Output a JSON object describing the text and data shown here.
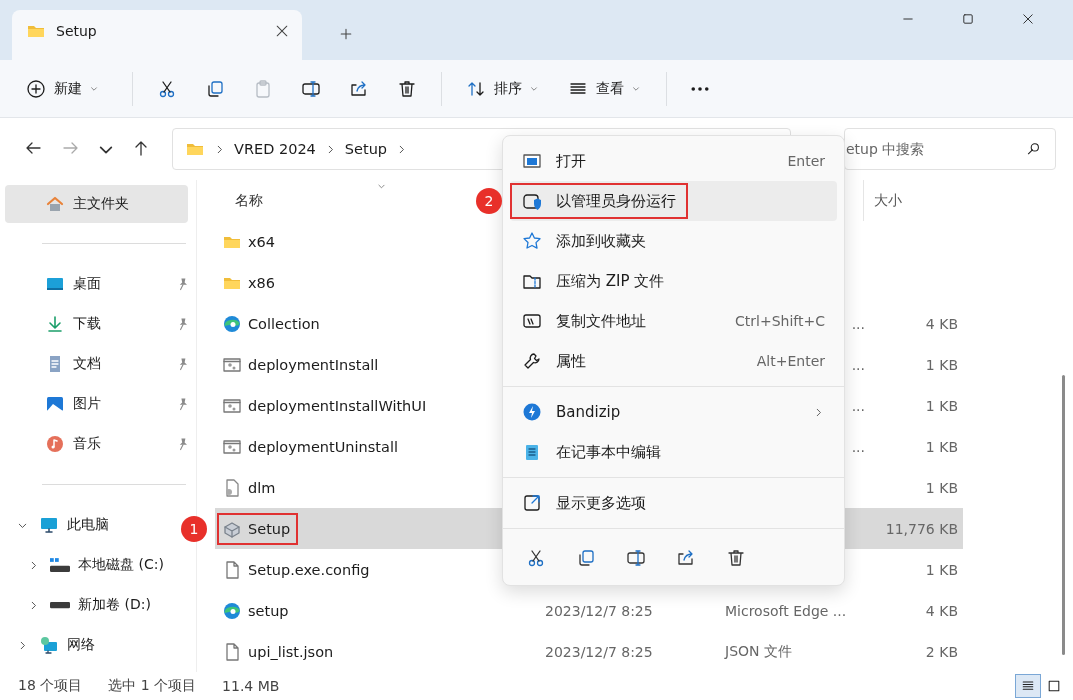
{
  "window": {
    "tab_title": "Setup"
  },
  "toolbar": {
    "groups": [
      [
        {
          "label": "新建",
          "dropdown": true,
          "disabled": false
        }
      ],
      [
        {
          "dropdown": false,
          "disabled": false
        },
        {
          "dropdown": false,
          "disabled": false
        },
        {
          "dropdown": false,
          "disabled": true
        },
        {
          "dropdown": false,
          "disabled": false
        },
        {
          "dropdown": false,
          "disabled": false
        },
        {
          "dropdown": false,
          "disabled": false
        }
      ],
      [
        {
          "label": "排序",
          "dropdown": true,
          "disabled": false
        },
        {
          "label": "查看",
          "dropdown": true,
          "disabled": false
        }
      ],
      [
        {
          "dropdown": false,
          "disabled": false
        }
      ]
    ]
  },
  "address": {
    "nav": [
      {
        "disabled": false
      },
      {
        "disabled": true
      },
      {
        "disabled": false
      },
      {
        "disabled": false
      }
    ],
    "path": [
      "VRED 2024",
      "Setup"
    ],
    "search": {
      "placeholder": "etup 中搜索"
    }
  },
  "sidebar": {
    "home": {
      "label": "主文件夹",
      "selected": true
    },
    "quick_access": [
      {
        "label": "桌面",
        "selected": false,
        "pinned": true
      },
      {
        "label": "下载",
        "selected": false,
        "pinned": true
      },
      {
        "label": "文档",
        "selected": false,
        "pinned": true
      },
      {
        "label": "图片",
        "selected": false,
        "pinned": true
      },
      {
        "label": "音乐",
        "selected": false,
        "pinned": true
      }
    ],
    "tree": [
      {
        "label": "此电脑",
        "selected": false,
        "expanded": true,
        "children": [
          {
            "label": "本地磁盘 (C:)",
            "selected": false,
            "expanded": false
          },
          {
            "label": "新加卷 (D:)",
            "selected": false,
            "expanded": false
          }
        ]
      },
      {
        "label": "网络",
        "selected": false,
        "expanded": false
      }
    ]
  },
  "table": {
    "columns": [
      {
        "label": "名称",
        "sorted": true
      },
      {
        "label": "大小",
        "sorted": false
      }
    ],
    "rows": [
      {
        "name": "x64",
        "kind": "folder",
        "selected": false,
        "outlined": false
      },
      {
        "name": "x86",
        "kind": "folder",
        "selected": false,
        "outlined": false
      },
      {
        "name": "Collection",
        "kind": "edge",
        "type": "...",
        "size": "4 KB",
        "selected": false,
        "outlined": false
      },
      {
        "name": "deploymentInstall",
        "kind": "script",
        "type": "...",
        "size": "1 KB",
        "selected": false,
        "outlined": false
      },
      {
        "name": "deploymentInstallWithUI",
        "kind": "script",
        "type": "...",
        "size": "1 KB",
        "selected": false,
        "outlined": false
      },
      {
        "name": "deploymentUninstall",
        "kind": "script",
        "type": "...",
        "size": "1 KB",
        "selected": false,
        "outlined": false
      },
      {
        "name": "dlm",
        "kind": "dll",
        "size": "1 KB",
        "selected": false,
        "outlined": false
      },
      {
        "name": "Setup",
        "kind": "installer",
        "size": "11,776 KB",
        "selected": true,
        "outlined": true,
        "badge": "1"
      },
      {
        "name": "Setup.exe.config",
        "kind": "file",
        "size": "1 KB",
        "selected": false,
        "outlined": false
      },
      {
        "name": "setup",
        "kind": "edge",
        "date": "2023/12/7 8:25",
        "type": "Microsoft Edge ...",
        "size": "4 KB",
        "selected": false,
        "outlined": false
      },
      {
        "name": "upi_list.json",
        "kind": "file",
        "date": "2023/12/7 8:25",
        "type": "JSON 文件",
        "size": "2 KB",
        "selected": false,
        "outlined": false
      }
    ]
  },
  "context_menu": {
    "sections": [
      [
        {
          "label": "打开",
          "shortcut": "Enter",
          "selected": false,
          "outlined": false,
          "submenu": false
        },
        {
          "label": "以管理员身份运行",
          "selected": true,
          "outlined": true,
          "badge": "2",
          "submenu": false
        },
        {
          "label": "添加到收藏夹",
          "selected": false,
          "outlined": false,
          "submenu": false
        },
        {
          "label": "压缩为 ZIP 文件",
          "selected": false,
          "outlined": false,
          "submenu": false
        },
        {
          "label": "复制文件地址",
          "shortcut": "Ctrl+Shift+C",
          "selected": false,
          "outlined": false,
          "submenu": false
        },
        {
          "label": "属性",
          "shortcut": "Alt+Enter",
          "selected": false,
          "outlined": false,
          "submenu": false
        }
      ],
      [
        {
          "label": "Bandizip",
          "selected": false,
          "outlined": false,
          "submenu": true
        },
        {
          "label": "在记事本中编辑",
          "selected": false,
          "outlined": false,
          "submenu": false
        }
      ],
      [
        {
          "label": "显示更多选项",
          "selected": false,
          "outlined": false,
          "submenu": false
        }
      ]
    ],
    "actions": [
      {
        "disabled": false
      },
      {
        "disabled": false
      },
      {
        "disabled": false
      },
      {
        "disabled": false
      },
      {
        "disabled": false
      }
    ]
  },
  "status_bar": {
    "count": "18 个项目",
    "selection": "选中 1 个项目",
    "size": "11.4 MB",
    "views": [
      {
        "selected": true
      },
      {
        "selected": false
      }
    ]
  }
}
